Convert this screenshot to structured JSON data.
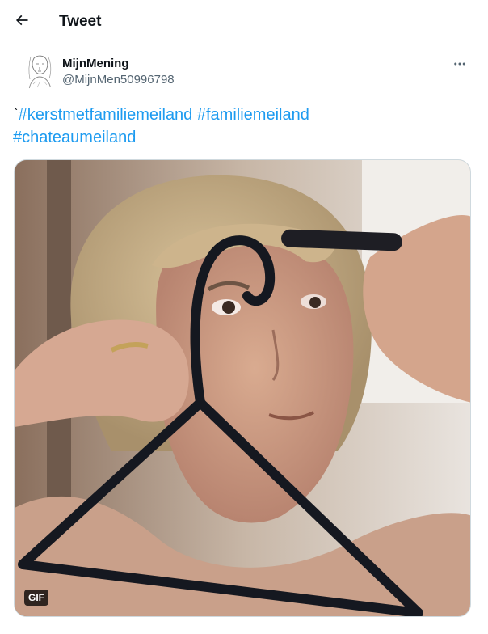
{
  "header": {
    "back_icon": "arrow-left-icon",
    "title": "Tweet"
  },
  "author": {
    "display_name": "MijnMening",
    "handle": "@MijnMen50996798",
    "avatar_icon": "sketch-portrait-avatar",
    "more_icon": "more-horizontal-icon"
  },
  "tweet": {
    "prefix": "`",
    "hashtags": [
      "#kerstmetfamiliemeiland",
      "#familiemeiland",
      "#chateaumeiland"
    ]
  },
  "media": {
    "badge": "GIF",
    "description_icon": "gif-woman-with-hanger"
  },
  "colors": {
    "text": "#0f1419",
    "secondary_text": "#536471",
    "link": "#1d9bf0",
    "border": "#cfd9de"
  }
}
